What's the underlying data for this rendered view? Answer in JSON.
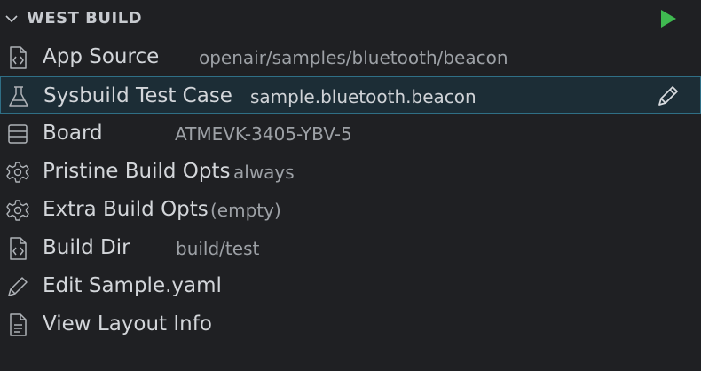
{
  "header": {
    "title": "WEST BUILD",
    "run_icon": "play-icon",
    "collapse_icon": "chevron-down-icon"
  },
  "items": [
    {
      "label": "App Source",
      "value": "openair/samples/bluetooth/beacon",
      "icon": "file-code-icon"
    },
    {
      "label": "Sysbuild Test Case",
      "value": "sample.bluetooth.beacon",
      "icon": "beaker-icon",
      "selected": true,
      "action_icon": "pencil-icon"
    },
    {
      "label": "Board",
      "value": "ATMEVK-3405-YBV-5",
      "icon": "server-icon"
    },
    {
      "label": "Pristine Build Opts",
      "value": "always",
      "icon": "gear-icon"
    },
    {
      "label": "Extra Build Opts",
      "value": "(empty)",
      "icon": "gear-icon"
    },
    {
      "label": "Build Dir",
      "value": "build/test",
      "icon": "file-code-icon"
    },
    {
      "label": "Edit Sample.yaml",
      "value": "",
      "icon": "pencil-icon"
    },
    {
      "label": "View Layout Info",
      "value": "",
      "icon": "file-text-icon"
    }
  ],
  "colors": {
    "background": "#1f2023",
    "selected_bg": "#1c2d36",
    "selected_border": "#2f6f86",
    "run_green": "#3fb950"
  }
}
